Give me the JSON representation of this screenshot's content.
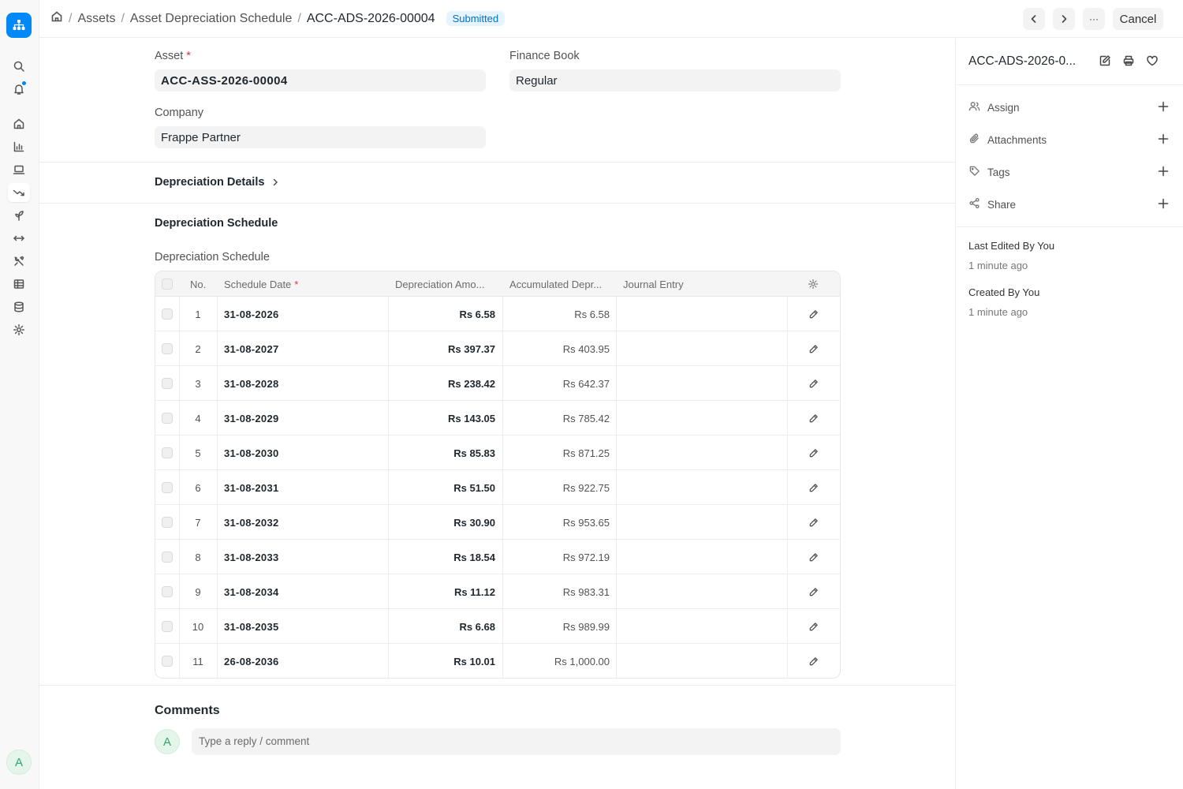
{
  "breadcrumb": {
    "items": [
      "Assets",
      "Asset Depreciation Schedule"
    ],
    "current": "ACC-ADS-2026-00004",
    "status": "Submitted"
  },
  "toolbar": {
    "more_label": "···",
    "cancel_label": "Cancel"
  },
  "form": {
    "asset_label": "Asset",
    "asset_value": "ACC-ASS-2026-00004",
    "finance_book_label": "Finance Book",
    "finance_book_value": "Regular",
    "company_label": "Company",
    "company_value": "Frappe Partner",
    "depreciation_details_label": "Depreciation Details",
    "schedule_section_title": "Depreciation Schedule",
    "schedule_table_label": "Depreciation Schedule"
  },
  "table": {
    "headers": {
      "no": "No.",
      "schedule_date": "Schedule Date",
      "depreciation_amount": "Depreciation Amo...",
      "accumulated": "Accumulated Depr...",
      "journal_entry": "Journal Entry"
    },
    "rows": [
      {
        "no": "1",
        "date": "31-08-2026",
        "amount": "Rs 6.58",
        "accumulated": "Rs 6.58"
      },
      {
        "no": "2",
        "date": "31-08-2027",
        "amount": "Rs 397.37",
        "accumulated": "Rs 403.95"
      },
      {
        "no": "3",
        "date": "31-08-2028",
        "amount": "Rs 238.42",
        "accumulated": "Rs 642.37"
      },
      {
        "no": "4",
        "date": "31-08-2029",
        "amount": "Rs 143.05",
        "accumulated": "Rs 785.42"
      },
      {
        "no": "5",
        "date": "31-08-2030",
        "amount": "Rs 85.83",
        "accumulated": "Rs 871.25"
      },
      {
        "no": "6",
        "date": "31-08-2031",
        "amount": "Rs 51.50",
        "accumulated": "Rs 922.75"
      },
      {
        "no": "7",
        "date": "31-08-2032",
        "amount": "Rs 30.90",
        "accumulated": "Rs 953.65"
      },
      {
        "no": "8",
        "date": "31-08-2033",
        "amount": "Rs 18.54",
        "accumulated": "Rs 972.19"
      },
      {
        "no": "9",
        "date": "31-08-2034",
        "amount": "Rs 11.12",
        "accumulated": "Rs 983.31"
      },
      {
        "no": "10",
        "date": "31-08-2035",
        "amount": "Rs 6.68",
        "accumulated": "Rs 989.99"
      },
      {
        "no": "11",
        "date": "26-08-2036",
        "amount": "Rs 10.01",
        "accumulated": "Rs 1,000.00"
      }
    ]
  },
  "comments": {
    "title": "Comments",
    "avatar_initial": "A",
    "placeholder": "Type a reply / comment"
  },
  "sidebar": {
    "title": "ACC-ADS-2026-0...",
    "assign_label": "Assign",
    "attachments_label": "Attachments",
    "tags_label": "Tags",
    "share_label": "Share",
    "last_edited_label": "Last Edited By You",
    "last_edited_time": "1 minute ago",
    "created_label": "Created By You",
    "created_time": "1 minute ago"
  },
  "user": {
    "avatar_initial": "A"
  },
  "colors": {
    "accent": "#0289f7",
    "status_bg": "#e6f4ff",
    "status_text": "#0070cc",
    "required": "#e03636"
  }
}
